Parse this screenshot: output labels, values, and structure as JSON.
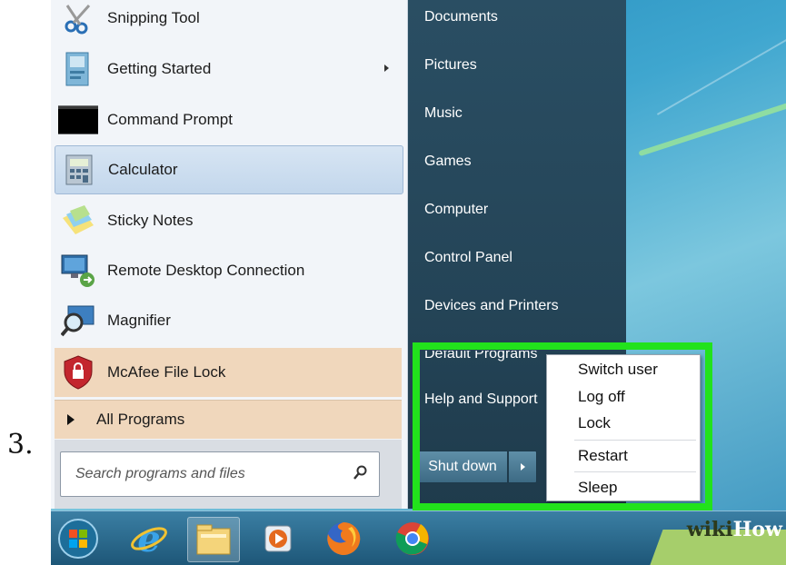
{
  "step_number": "3.",
  "start_menu": {
    "programs": [
      {
        "label": "Snipping Tool",
        "icon": "scissors-icon",
        "has_submenu": false
      },
      {
        "label": "Getting Started",
        "icon": "getting-started-icon",
        "has_submenu": true
      },
      {
        "label": "Command Prompt",
        "icon": "command-prompt-icon",
        "has_submenu": false
      },
      {
        "label": "Calculator",
        "icon": "calculator-icon",
        "has_submenu": false
      },
      {
        "label": "Sticky Notes",
        "icon": "sticky-notes-icon",
        "has_submenu": false
      },
      {
        "label": "Remote Desktop Connection",
        "icon": "remote-desktop-icon",
        "has_submenu": false
      },
      {
        "label": "Magnifier",
        "icon": "magnifier-icon",
        "has_submenu": false
      },
      {
        "label": "McAfee File Lock",
        "icon": "mcafee-shield-icon",
        "has_submenu": false
      }
    ],
    "all_programs_label": "All Programs",
    "search_placeholder": "Search programs and files"
  },
  "right_pane": {
    "items": [
      "Documents",
      "Pictures",
      "Music",
      "Games",
      "Computer",
      "Control Panel",
      "Devices and Printers",
      "Default Programs",
      "Help and Support"
    ],
    "shutdown_label": "Shut down"
  },
  "shutdown_menu": {
    "items": [
      "Switch user",
      "Log off",
      "Lock",
      "Restart",
      "Sleep"
    ]
  },
  "taskbar": {
    "items": [
      "start-orb-icon",
      "internet-explorer-icon",
      "file-explorer-icon",
      "media-player-icon",
      "firefox-icon",
      "chrome-icon"
    ]
  },
  "watermark": {
    "wiki": "wiki",
    "how": "How"
  },
  "colors": {
    "highlight": "#22e21c",
    "right_pane": "#244457",
    "orange_row": "#f0d7bc"
  }
}
